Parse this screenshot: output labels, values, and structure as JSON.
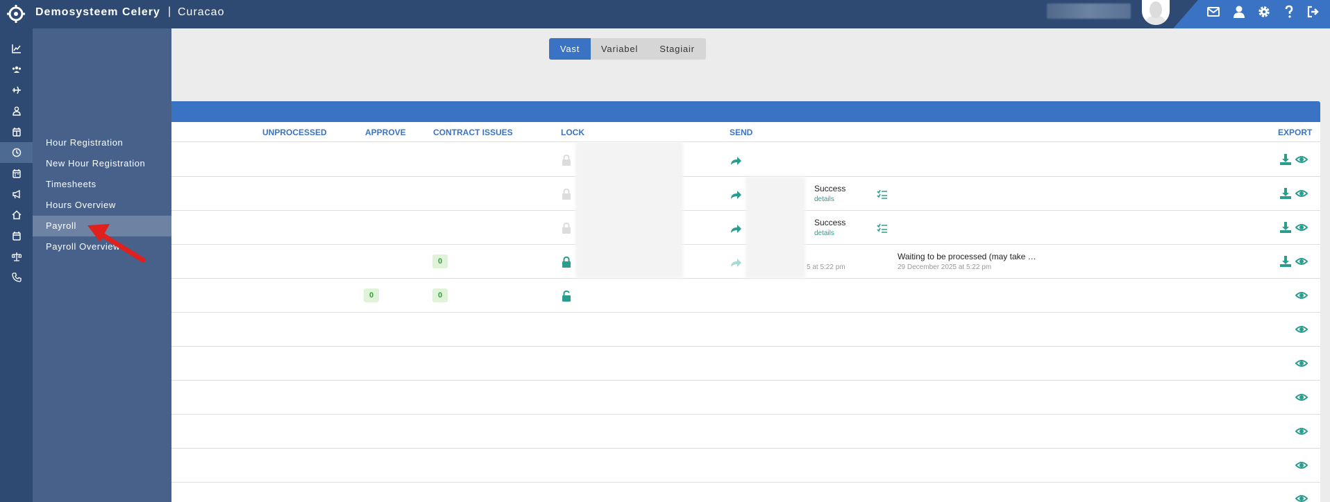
{
  "app": {
    "brand": "Demosysteem Celery",
    "separator": "|",
    "organization": "Curacao"
  },
  "topbar_icons": [
    "envelope-icon",
    "user-icon",
    "gear-icon",
    "help-icon",
    "logout-icon"
  ],
  "sidebar_icons": [
    "chart-icon",
    "users-icon",
    "plane-icon",
    "person-icon",
    "calendar-gift-icon",
    "clock-icon",
    "calendar-icon",
    "megaphone-icon",
    "home-icon",
    "calendar-blank-icon",
    "scale-icon",
    "phone-icon"
  ],
  "submenu": {
    "items": [
      {
        "label": "Hour Registration",
        "active": false
      },
      {
        "label": "New Hour Registration",
        "active": false
      },
      {
        "label": "Timesheets",
        "active": false
      },
      {
        "label": "Hours Overview",
        "active": false
      },
      {
        "label": "Payroll",
        "active": true
      },
      {
        "label": "Payroll Overview",
        "active": false
      }
    ]
  },
  "tabs": [
    {
      "label": "Vast",
      "active": true
    },
    {
      "label": "Variabel",
      "active": false
    },
    {
      "label": "Stagiair",
      "active": false
    }
  ],
  "table": {
    "headers": {
      "unprocessed": "UNPROCESSED",
      "approve": "APPROVE",
      "contract_issues": "CONTRACT ISSUES",
      "lock": "LOCK",
      "send": "SEND",
      "export": "EXPORT"
    },
    "rows": [
      {
        "approve": "",
        "contract_issues": "",
        "lock": "locked-disabled",
        "send": "send",
        "status": "",
        "status_link": "",
        "message": "",
        "message_date": "",
        "export": true
      },
      {
        "approve": "",
        "contract_issues": "",
        "lock": "locked-disabled",
        "send": "send",
        "status": "Success",
        "status_link": "details",
        "message": "",
        "message_date": "",
        "export": true
      },
      {
        "approve": "",
        "contract_issues": "",
        "lock": "locked-disabled",
        "send": "send",
        "status": "Success",
        "status_link": "details",
        "message": "",
        "message_date": "",
        "export": true
      },
      {
        "approve": "",
        "contract_issues": "0",
        "lock": "locked",
        "send": "send-disabled",
        "status_partial": "5 at 5:22 pm",
        "message": "Waiting to be processed (may take …",
        "message_date": "29 December 2025 at 5:22 pm",
        "export": true
      },
      {
        "approve": "0",
        "contract_issues": "0",
        "lock": "unlocked",
        "export": false
      },
      {
        "export": false
      },
      {
        "export": false
      },
      {
        "export": false
      },
      {
        "export": false
      },
      {
        "export": false
      },
      {
        "export": false
      }
    ]
  },
  "colors": {
    "header_bg": "#2e4a72",
    "accent_blue": "#3a73c4",
    "teal": "#2a9d8f"
  }
}
